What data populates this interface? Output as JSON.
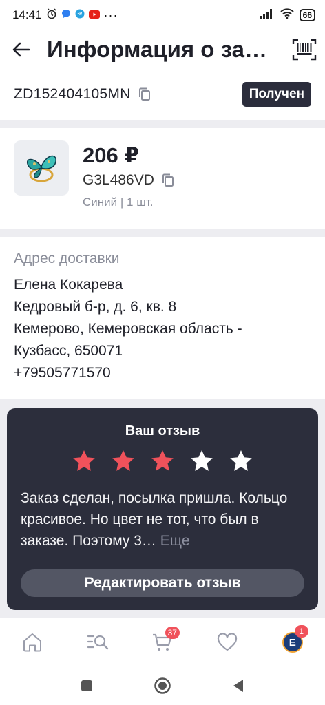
{
  "status_bar": {
    "time": "14:41",
    "battery": "66"
  },
  "header": {
    "title": "Информация о заказе"
  },
  "order": {
    "id": "ZD152404105MN",
    "status": "Получен"
  },
  "product": {
    "price": "206 ₽",
    "sku": "G3L486VD",
    "variant": "Синий | 1 шт."
  },
  "address": {
    "label": "Адрес доставки",
    "name": "Елена Кокарева",
    "street": "Кедровый б-р, д. 6, кв. 8",
    "city": "Кемерово, Кемеровская область -",
    "region_zip": "Кузбасс, 650071",
    "phone": "+79505771570"
  },
  "review": {
    "title": "Ваш отзыв",
    "rating": 3,
    "rating_max": 5,
    "text": "Заказ сделан, посылка пришла. Кольцо красивое. Но цвет не тот, что был в заказе. Поэтому 3…",
    "more_label": "Еще",
    "edit_label": "Редактировать отзыв"
  },
  "nav": {
    "cart_count": "37",
    "profile_count": "1",
    "avatar_letter": "E"
  },
  "colors": {
    "star_filled": "#f0525b",
    "star_empty": "#ffffff",
    "dark_panel": "#2c2e3c",
    "badge_red": "#f0525b"
  }
}
